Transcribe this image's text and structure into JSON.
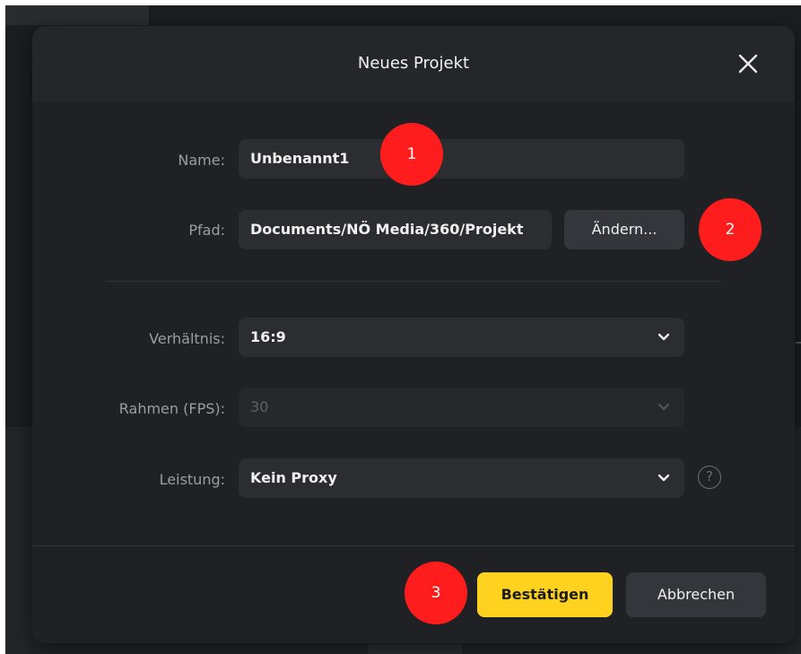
{
  "dialog": {
    "title": "Neues Projekt",
    "close_icon": "close-icon"
  },
  "form": {
    "name_label": "Name:",
    "name_value": "Unbenannt1",
    "path_label": "Pfad:",
    "path_value": "Documents/NÖ Media/360/Projekt",
    "change_button": "Ändern...",
    "ratio_label": "Verhältnis:",
    "ratio_value": "16:9",
    "fps_label": "Rahmen (FPS):",
    "fps_value": "30",
    "performance_label": "Leistung:",
    "performance_value": "Kein Proxy",
    "help_icon": "help-circle-icon",
    "help_glyph": "?"
  },
  "footer": {
    "confirm_button": "Bestätigen",
    "cancel_button": "Abbrechen"
  },
  "annotations": {
    "marker_1": "1",
    "marker_2": "2",
    "marker_3": "3"
  },
  "colors": {
    "accent": "#ffd21f",
    "marker": "#ff1c1c",
    "dialog_bg": "#202124"
  }
}
